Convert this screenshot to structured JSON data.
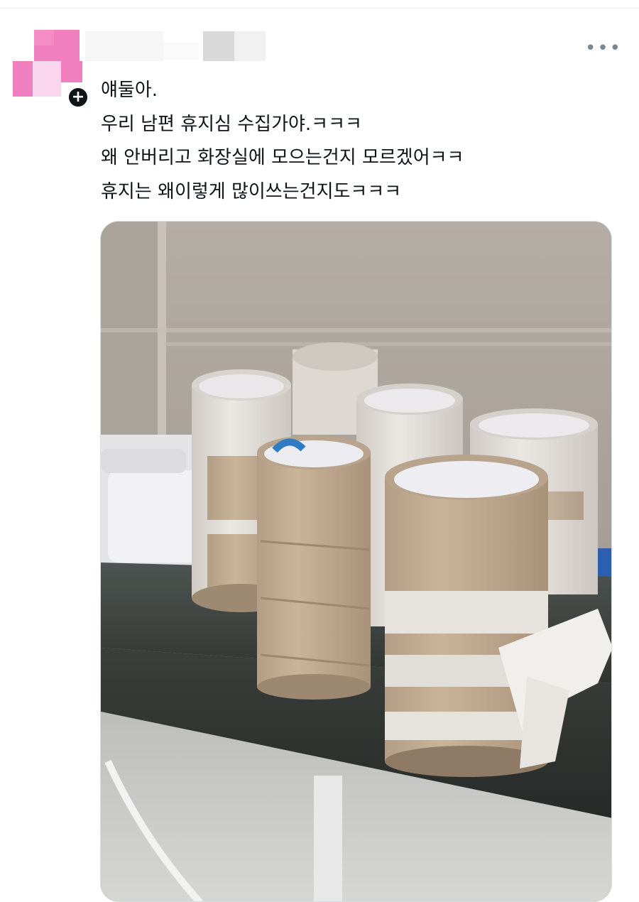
{
  "post": {
    "lines": [
      "얘둘아.",
      "우리 남편 휴지심 수집가야.ㅋㅋㅋ",
      "왜 안버리고 화장실에 모으는건지 모르겠어ㅋㅋ",
      "휴지는 왜이렇게 많이쓰는건지도ㅋㅋㅋ"
    ]
  },
  "header": {
    "more_icon": "more-horizontal-icon",
    "more_glyph": "•••",
    "badge_icon": "plus-icon",
    "badge_glyph": "+"
  },
  "colors": {
    "censor_pink": "#f07fbf",
    "censor_light_pink": "#f9d6ec",
    "censor_gray": "#d9d9d9",
    "text": "#0f1419",
    "muted": "#7a8691"
  },
  "photo": {
    "subject": "empty toilet paper rolls on a granite bathroom shelf"
  }
}
